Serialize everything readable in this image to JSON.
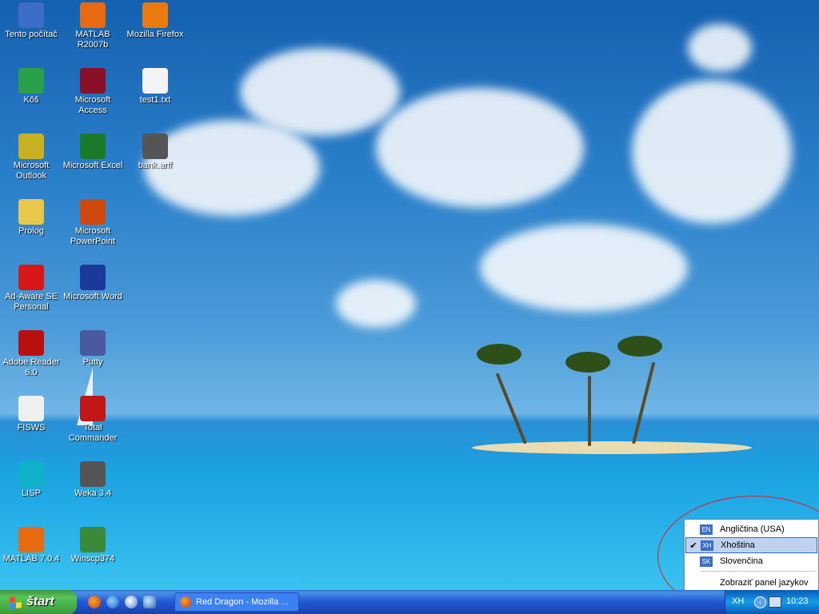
{
  "desktop": {
    "icons": [
      {
        "label": "Tento počítač",
        "icon": "my-computer-icon",
        "color": "#3a6ec8"
      },
      {
        "label": "Kôš",
        "icon": "recycle-bin-icon",
        "color": "#2aa04a"
      },
      {
        "label": "Microsoft Outlook",
        "icon": "outlook-icon",
        "color": "#c8b020"
      },
      {
        "label": "Prolog",
        "icon": "folder-icon",
        "color": "#e8c84a"
      },
      {
        "label": "Ad-Aware SE Personal",
        "icon": "ad-aware-icon",
        "color": "#d81818"
      },
      {
        "label": "Adobe Reader 6.0",
        "icon": "adobe-reader-icon",
        "color": "#b81010"
      },
      {
        "label": "FISWS",
        "icon": "fisws-icon",
        "color": "#f0f0f0"
      },
      {
        "label": "LISP",
        "icon": "lisp-icon",
        "color": "#10b0c8"
      },
      {
        "label": "MATLAB 7.0.4",
        "icon": "matlab-icon",
        "color": "#e86a10"
      },
      {
        "label": "MATLAB R2007b",
        "icon": "matlab-icon",
        "color": "#e86a10"
      },
      {
        "label": "Microsoft Access",
        "icon": "access-icon",
        "color": "#8a1028"
      },
      {
        "label": "Microsoft Excel",
        "icon": "excel-icon",
        "color": "#1a7a2a"
      },
      {
        "label": "Microsoft PowerPoint",
        "icon": "powerpoint-icon",
        "color": "#d04a10"
      },
      {
        "label": "Microsoft Word",
        "icon": "word-icon",
        "color": "#1a3a9a"
      },
      {
        "label": "Putty",
        "icon": "putty-icon",
        "color": "#4a5aa0"
      },
      {
        "label": "Total Commander",
        "icon": "total-commander-icon",
        "color": "#c01818"
      },
      {
        "label": "Weka 3.4",
        "icon": "weka-icon",
        "color": "#555555"
      },
      {
        "label": "Winscp374",
        "icon": "winscp-icon",
        "color": "#3a8a3a"
      },
      {
        "label": "Mozilla Firefox",
        "icon": "firefox-icon",
        "color": "#e87a10"
      },
      {
        "label": "test1.txt",
        "icon": "text-file-icon",
        "color": "#f4f4f4"
      },
      {
        "label": "bank.arff",
        "icon": "weka-icon",
        "color": "#555555"
      }
    ]
  },
  "taskbar": {
    "start_label": "štart",
    "quick_launch": [
      "firefox-icon",
      "internet-explorer-icon",
      "media-player-icon",
      "outlook-express-icon"
    ],
    "task_title": "Red Dragon - Mozilla ...",
    "tray": {
      "language": "XH",
      "clock": "10:23"
    }
  },
  "language_menu": {
    "items": [
      {
        "code": "EN",
        "label": "Angličtina (USA)",
        "checked": false
      },
      {
        "code": "XH",
        "label": "Xhoština",
        "checked": true
      },
      {
        "code": "SK",
        "label": "Slovenčina",
        "checked": false
      }
    ],
    "show_bar_label": "Zobraziť panel jazykov"
  },
  "colors": {
    "taskbar": "#2157d7",
    "start": "#3c9a3c",
    "highlight": "#c1d2ee",
    "annotation": "#dd2222"
  }
}
